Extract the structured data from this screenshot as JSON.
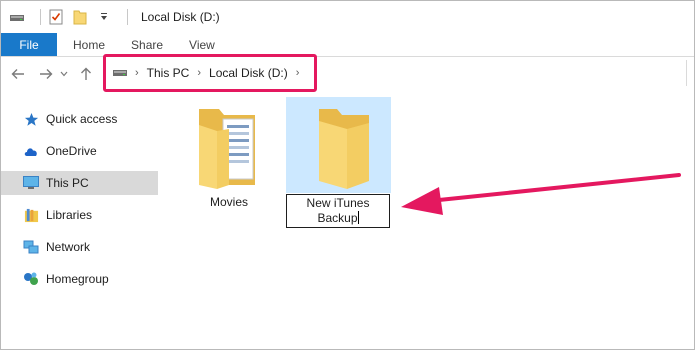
{
  "window": {
    "title": "Local Disk (D:)"
  },
  "ribbon": {
    "tabs": [
      "File",
      "Home",
      "Share",
      "View"
    ]
  },
  "address": {
    "crumbs": [
      "This PC",
      "Local Disk (D:)"
    ]
  },
  "sidebar": {
    "items": [
      {
        "label": "Quick access",
        "icon": "star-icon",
        "selected": false
      },
      {
        "label": "OneDrive",
        "icon": "cloud-icon",
        "selected": false
      },
      {
        "label": "This PC",
        "icon": "computer-icon",
        "selected": true
      },
      {
        "label": "Libraries",
        "icon": "library-icon",
        "selected": false
      },
      {
        "label": "Network",
        "icon": "network-icon",
        "selected": false
      },
      {
        "label": "Homegroup",
        "icon": "homegroup-icon",
        "selected": false
      }
    ]
  },
  "files": [
    {
      "name": "Movies",
      "icon": "folder-with-documents-icon"
    },
    {
      "name_line1": "New iTunes",
      "name_line2": "Backup",
      "icon": "folder-icon",
      "selected": true,
      "renaming": true
    }
  ],
  "colors": {
    "accent": "#1979ca",
    "highlight": "#e4185f",
    "selection": "#cce8ff",
    "folder": "#f8d775"
  }
}
